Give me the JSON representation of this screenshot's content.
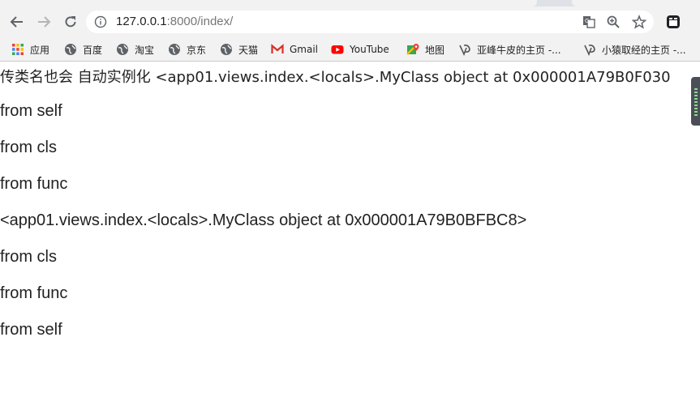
{
  "browser": {
    "url_host": "127.0.0.1",
    "url_path": ":8000/index/"
  },
  "bookmarks": [
    {
      "label": "应用",
      "icon": "apps-grid-icon"
    },
    {
      "label": "百度",
      "icon": "globe-icon"
    },
    {
      "label": "淘宝",
      "icon": "globe-icon"
    },
    {
      "label": "京东",
      "icon": "globe-icon"
    },
    {
      "label": "天猫",
      "icon": "globe-icon"
    },
    {
      "label": "Gmail",
      "icon": "gmail-icon"
    },
    {
      "label": "YouTube",
      "icon": "youtube-icon"
    },
    {
      "label": "地图",
      "icon": "maps-icon"
    },
    {
      "label": "亚峰牛皮的主页 -...",
      "icon": "blog-icon"
    },
    {
      "label": "小猿取经的主页 -...",
      "icon": "blog-icon"
    }
  ],
  "page": {
    "lines": [
      "传类名也会 自动实例化 <app01.views.index.<locals>.MyClass object at 0x000001A79B0F030",
      "from self",
      "from cls",
      "from func",
      "<app01.views.index.<locals>.MyClass object at 0x000001A79B0BFBC8>",
      "from cls",
      "from func",
      "from self"
    ]
  }
}
